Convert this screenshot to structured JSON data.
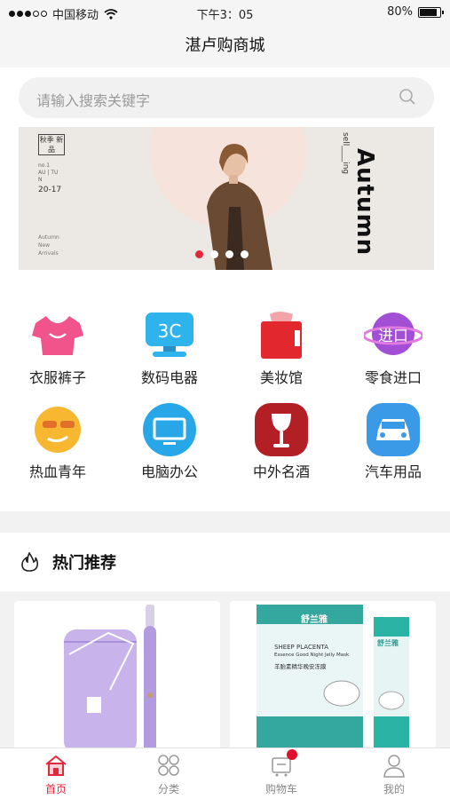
{
  "status_bar": {
    "carrier": "中国移动",
    "time": "下午3：05",
    "battery": "80%"
  },
  "page_title": "湛卢购商城",
  "search": {
    "placeholder": "请输入搜索关键字"
  },
  "banner": {
    "badge": "秋季 新品",
    "date": "20-17",
    "headline": "Autumn",
    "side_text": "sell____ing",
    "pager_count": 4,
    "pager_active": 1
  },
  "categories": [
    {
      "label": "衣服裤子",
      "icon": "tshirt-icon"
    },
    {
      "label": "数码电器",
      "icon": "3c-monitor-icon"
    },
    {
      "label": "美妆馆",
      "icon": "shopping-bag-icon"
    },
    {
      "label": "零食进口",
      "icon": "import-planet-icon"
    },
    {
      "label": "热血青年",
      "icon": "cool-face-icon"
    },
    {
      "label": "电脑办公",
      "icon": "computer-icon"
    },
    {
      "label": "中外名酒",
      "icon": "wine-glass-icon"
    },
    {
      "label": "汽车用品",
      "icon": "car-icon"
    }
  ],
  "hot_section": {
    "title": "热门推荐"
  },
  "products": [
    {
      "image": "electric-toothbrush-with-case"
    },
    {
      "image": "sheep-placenta-jelly-mask-box",
      "brand": "舒兰雅",
      "name_en": "SHEEP PLACENTA",
      "subtitle": "Essence Good Night Jelly Mask",
      "name_cn": "羊胎素精华晚安冻膜"
    }
  ],
  "tabbar": [
    {
      "label": "首页",
      "icon": "home-icon",
      "active": true
    },
    {
      "label": "分类",
      "icon": "grid-circles-icon",
      "active": false
    },
    {
      "label": "购物车",
      "icon": "cart-icon",
      "active": false
    },
    {
      "label": "我的",
      "icon": "user-icon",
      "active": false
    }
  ],
  "colors": {
    "accent": "#e0293c",
    "page_bg": "#f2f2f2"
  }
}
